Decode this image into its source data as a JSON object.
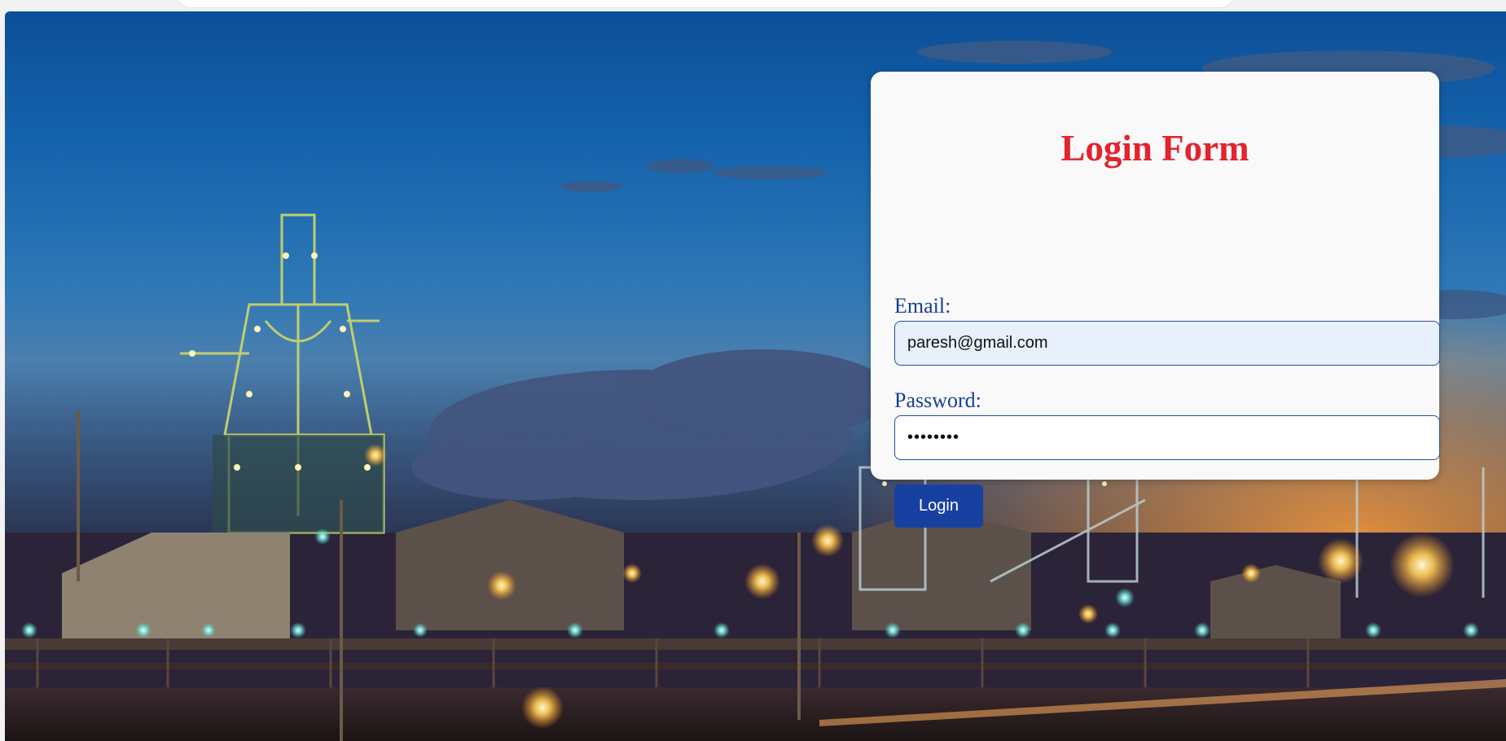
{
  "login_form": {
    "title": "Login Form",
    "email_label": "Email:",
    "email_value": "paresh@gmail.com",
    "password_label": "Password:",
    "password_value": "********",
    "login_button": "Login"
  },
  "colors": {
    "title": "#e3232d",
    "label": "#1b3f93",
    "button": "#1740a0",
    "input_border": "#244ea0",
    "email_input_bg": "#e8f0fc"
  }
}
